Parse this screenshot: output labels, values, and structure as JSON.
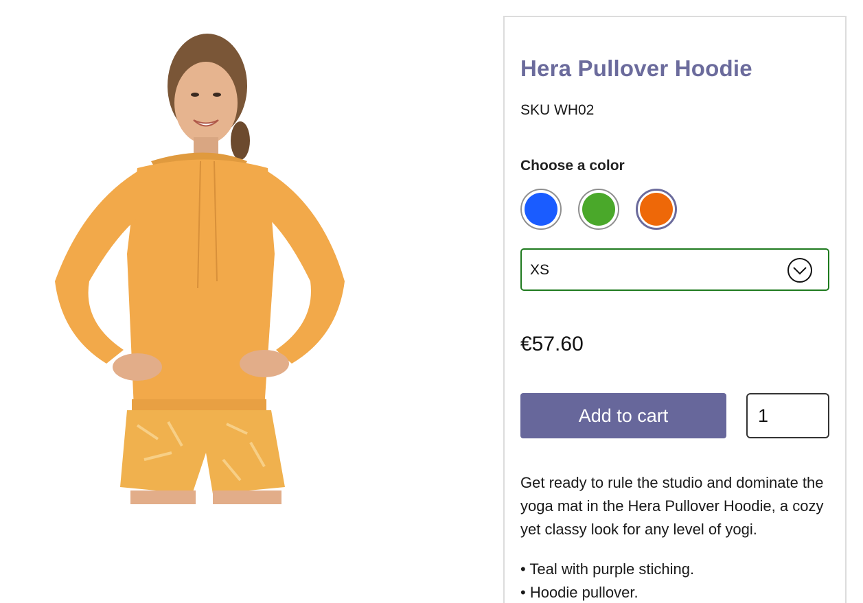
{
  "product": {
    "title": "Hera Pullover Hoodie",
    "sku": "SKU WH02",
    "price": "€57.60",
    "description": "Get ready to rule the studio and dominate the yoga mat in the Hera Pullover Hoodie, a cozy yet classy look for any level of yogi.",
    "features": [
      "• Teal with purple stiching.",
      "• Hoodie pullover."
    ]
  },
  "color_picker": {
    "label": "Choose a color",
    "swatches": [
      {
        "color": "#1a5cff",
        "selected": false
      },
      {
        "color": "#4aa82a",
        "selected": false
      },
      {
        "color": "#ee6808",
        "selected": true
      }
    ]
  },
  "size_select": {
    "value": "XS",
    "icon": "chevron-down-icon"
  },
  "cart": {
    "button_label": "Add to cart",
    "quantity": "1"
  },
  "colors": {
    "accent": "#67679b",
    "title": "#6b6b9c",
    "select_border": "#1e7a1e",
    "hoodie": "#f2a94a"
  }
}
